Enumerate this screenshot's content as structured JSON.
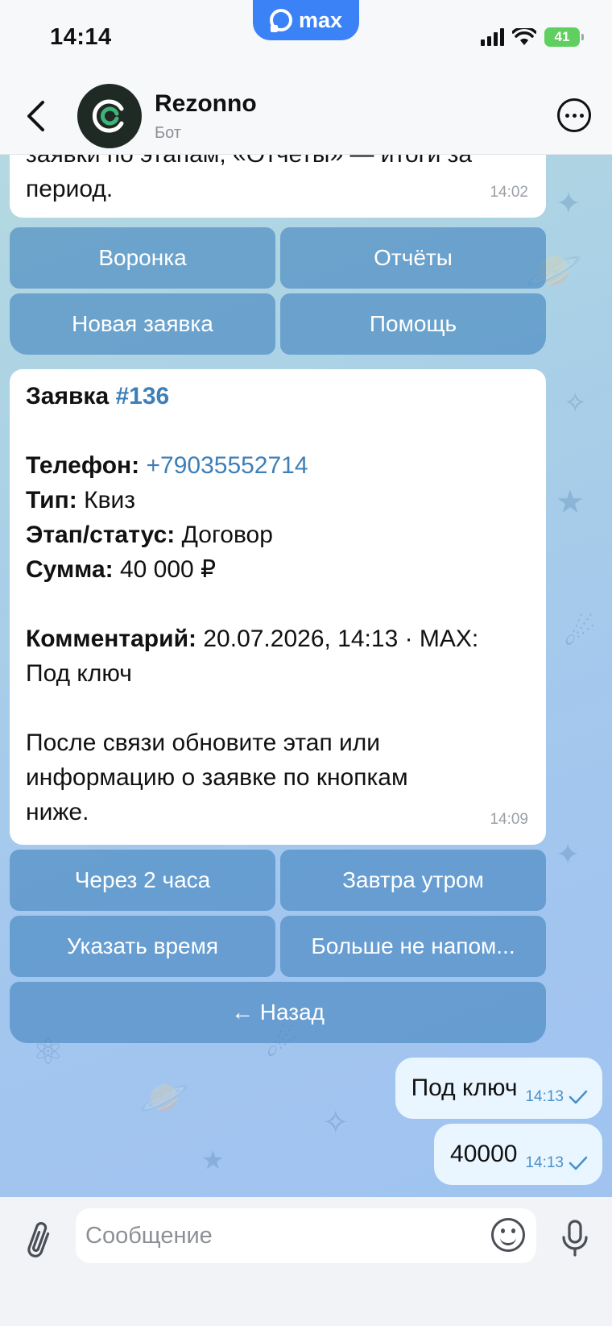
{
  "status_bar": {
    "time": "14:14",
    "brand": "max",
    "battery": "41"
  },
  "header": {
    "title": "Rezonno",
    "subtitle": "Бот"
  },
  "messages": {
    "intro": {
      "line1": "заявки по этапам, «Отчеты» — итоги за",
      "line2": "период.",
      "time": "14:02"
    },
    "intro_keyboard": [
      [
        "Воронка",
        "Отчёты"
      ],
      [
        "Новая заявка",
        "Помощь"
      ]
    ],
    "lead": {
      "title_label": "Заявка",
      "title_number": "#136",
      "phone_label": "Телефон:",
      "phone_value": "+79035552714",
      "type_label": "Тип:",
      "type_value": "Квиз",
      "stage_label": "Этап/статус:",
      "stage_value": "Договор",
      "sum_label": "Сумма:",
      "sum_value": "40 000 ₽",
      "comment_label": "Комментарий:",
      "comment_value": "20.07.2026, 14:13 · MAX:",
      "comment_line2": "Под ключ",
      "footer_line1": "После связи обновите этап или",
      "footer_line2": "информацию о заявке по кнопкам",
      "footer_line3": "ниже.",
      "time": "14:09"
    },
    "lead_keyboard": [
      [
        "Через 2 часа",
        "Завтра утром"
      ],
      [
        "Указать время",
        "Больше не напом..."
      ],
      [
        "← Назад"
      ]
    ],
    "outgoing": [
      {
        "text": "Под ключ",
        "time": "14:13"
      },
      {
        "text": "40000",
        "time": "14:13"
      }
    ]
  },
  "composer": {
    "placeholder": "Сообщение"
  },
  "colors": {
    "brand_blue": "#3b82f6",
    "link": "#3d7fb8",
    "keyboard_button": "#4284be",
    "outgoing_bubble": "#eaf6ff"
  },
  "icons": [
    "back-icon",
    "more-icon",
    "attach-icon",
    "emoji-icon",
    "mic-icon",
    "check-icon",
    "signal-icon",
    "wifi-icon",
    "battery-icon"
  ]
}
